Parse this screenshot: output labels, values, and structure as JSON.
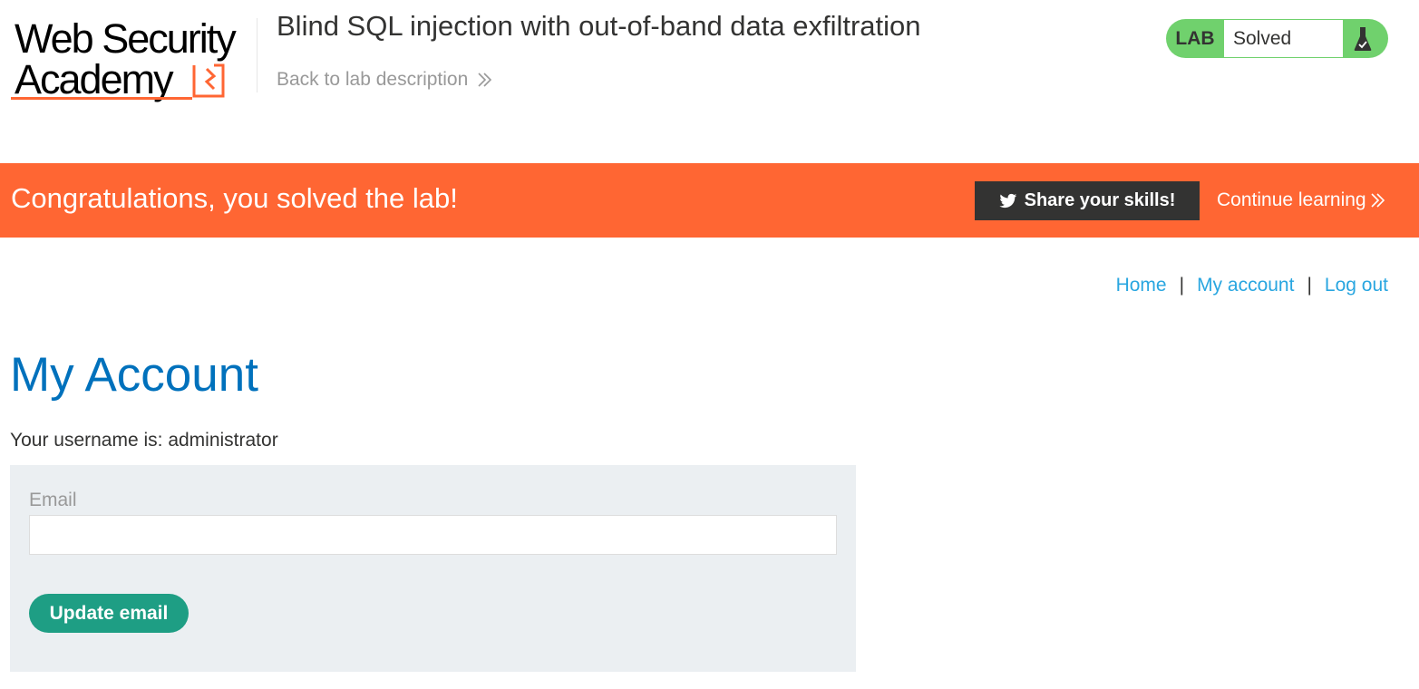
{
  "header": {
    "logo": {
      "line1": "Web Security",
      "line2": "Academy"
    },
    "lab_title": "Blind SQL injection with out-of-band data exfiltration",
    "back_link": "Back to lab description",
    "lab_status": {
      "label": "LAB",
      "status": "Solved"
    }
  },
  "banner": {
    "message": "Congratulations, you solved the lab!",
    "share_button": "Share your skills!",
    "continue_link": "Continue learning"
  },
  "nav": {
    "home": "Home",
    "separator": "|",
    "my_account": "My account",
    "log_out": "Log out"
  },
  "main": {
    "title": "My Account",
    "username_line": "Your username is: administrator",
    "form": {
      "email_label": "Email",
      "email_value": "",
      "update_button": "Update email"
    }
  },
  "colors": {
    "brand_orange": "#ff6633",
    "lab_green": "#70d16d",
    "link_blue": "#29a6e0",
    "title_blue": "#0071bc",
    "button_green": "#1e9e84",
    "form_bg": "#ebeff2"
  },
  "icons": {
    "logo_mark": "academy-logo-icon",
    "back_chevron": "double-chevron-right-icon",
    "flask": "flask-check-icon",
    "twitter": "twitter-icon",
    "continue_chevron": "double-chevron-right-icon"
  }
}
